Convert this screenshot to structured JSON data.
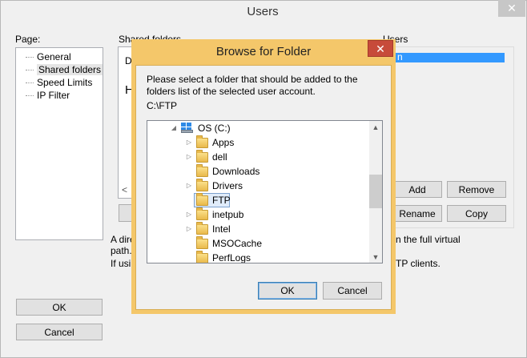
{
  "window": {
    "title": "Users",
    "close_glyph": "✕"
  },
  "page_panel": {
    "label": "Page:",
    "items": [
      {
        "label": "General"
      },
      {
        "label": "Shared folders"
      },
      {
        "label": "Speed Limits"
      },
      {
        "label": "IP Filter"
      }
    ],
    "selected": "Shared folders"
  },
  "shared_folders": {
    "label": "Shared folders",
    "header_clip": "D",
    "home_clip": "H",
    "scroll_left_glyph": "<",
    "desc_line1_clip": "A dire",
    "desc_line2_clip": "path.",
    "desc_line3_clip": "If usin"
  },
  "users_panel": {
    "label": "Users",
    "selected_item_clip": "n",
    "add_label": "Add",
    "remove_label": "Remove",
    "rename_label": "Rename",
    "copy_label": "Copy",
    "virtual_path_clip": "n the full virtual",
    "ftp_clients_clip": "TP clients."
  },
  "footer": {
    "ok_label": "OK",
    "cancel_label": "Cancel"
  },
  "browse_dialog": {
    "title": "Browse for Folder",
    "close_glyph": "✕",
    "instruction": "Please select a folder that should be added to the folders list of the selected user account.",
    "current_path": "C:\\FTP",
    "drive_label": "OS (C:)",
    "folders": [
      {
        "name": "Apps",
        "expandable": true
      },
      {
        "name": "dell",
        "expandable": true
      },
      {
        "name": "Downloads",
        "expandable": false
      },
      {
        "name": "Drivers",
        "expandable": true
      },
      {
        "name": "FTP",
        "expandable": false,
        "selected": true
      },
      {
        "name": "inetpub",
        "expandable": true
      },
      {
        "name": "Intel",
        "expandable": true
      },
      {
        "name": "MSOCache",
        "expandable": false
      },
      {
        "name": "PerfLogs",
        "expandable": false
      }
    ],
    "ok_label": "OK",
    "cancel_label": "Cancel",
    "scroll_up_glyph": "▲",
    "scroll_down_glyph": "▼"
  },
  "colors": {
    "dialog_frame": "#f4c76a",
    "close_red": "#c74b3a",
    "selection_blue": "#3399ff"
  }
}
